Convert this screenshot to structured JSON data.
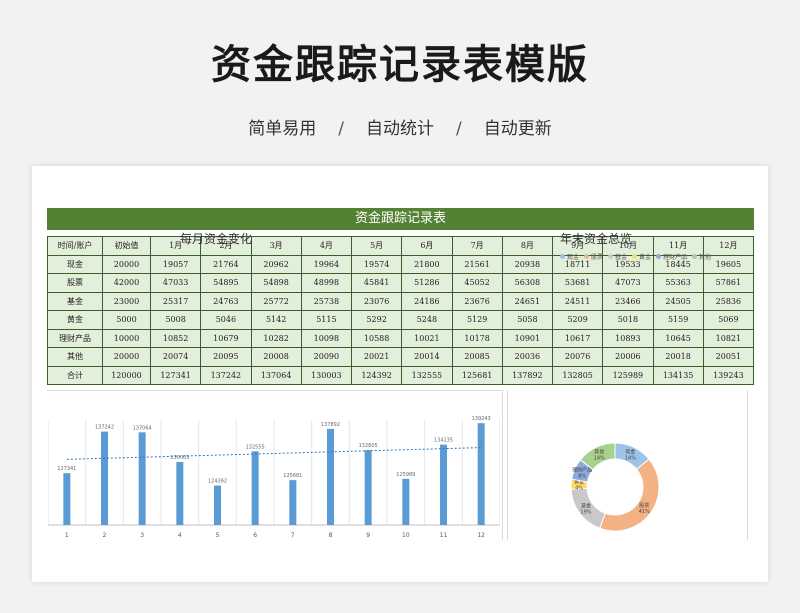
{
  "header": {
    "title": "资金跟踪记录表模版",
    "tags": [
      "简单易用",
      "自动统计",
      "自动更新"
    ],
    "separator": "/"
  },
  "sheet": {
    "banner": "资金跟踪记录表",
    "columns": [
      "时间/账户",
      "初始值",
      "1月",
      "2月",
      "3月",
      "4月",
      "5月",
      "6月",
      "7月",
      "8月",
      "9月",
      "10月",
      "11月",
      "12月"
    ],
    "rows": [
      [
        "现金",
        "20000",
        "19057",
        "21764",
        "20962",
        "19964",
        "19574",
        "21800",
        "21561",
        "20938",
        "18711",
        "19533",
        "18445",
        "19605"
      ],
      [
        "股票",
        "42000",
        "47033",
        "54895",
        "54898",
        "48998",
        "45841",
        "51286",
        "45052",
        "56308",
        "53681",
        "47073",
        "55363",
        "57861"
      ],
      [
        "基金",
        "23000",
        "25317",
        "24763",
        "25772",
        "25738",
        "23076",
        "24186",
        "23676",
        "24651",
        "24511",
        "23466",
        "24505",
        "25836"
      ],
      [
        "黄金",
        "5000",
        "5008",
        "5046",
        "5142",
        "5115",
        "5292",
        "5248",
        "5129",
        "5058",
        "5209",
        "5018",
        "5159",
        "5069"
      ],
      [
        "理财产品",
        "10000",
        "10852",
        "10679",
        "10282",
        "10098",
        "10588",
        "10021",
        "10178",
        "10901",
        "10617",
        "10893",
        "10645",
        "10821"
      ],
      [
        "其他",
        "20000",
        "20074",
        "20095",
        "20008",
        "20090",
        "20021",
        "20014",
        "20085",
        "20036",
        "20076",
        "20006",
        "20018",
        "20051"
      ],
      [
        "合计",
        "120000",
        "127341",
        "137242",
        "137064",
        "130003",
        "124392",
        "132555",
        "125681",
        "137892",
        "132805",
        "125989",
        "134135",
        "139243"
      ]
    ]
  },
  "chart_data": [
    {
      "type": "bar",
      "title": "每月资金变化",
      "categories": [
        "1",
        "2",
        "3",
        "4",
        "5",
        "6",
        "7",
        "8",
        "9",
        "10",
        "11",
        "12"
      ],
      "values": [
        127341,
        137242,
        137064,
        130003,
        124392,
        132555,
        125681,
        137892,
        132805,
        125989,
        134135,
        139243
      ],
      "ylim": [
        115000,
        140000
      ],
      "trendline": true,
      "color": "#5b9bd5",
      "trend_color": "#2e75b6"
    },
    {
      "type": "pie",
      "title": "年末资金总览",
      "style": "donut",
      "legend": "top",
      "labels": [
        "现金",
        "股票",
        "基金",
        "黄金",
        "理财产品",
        "其他"
      ],
      "values": [
        19605,
        57861,
        25836,
        5069,
        10821,
        20051
      ],
      "percent_labels": [
        "14%",
        "41%",
        "19%",
        "4%",
        "8%",
        "14%"
      ],
      "colors": [
        "#9dc3e6",
        "#f4b183",
        "#c9c9c9",
        "#ffd966",
        "#8faadc",
        "#a9d18e"
      ]
    }
  ]
}
